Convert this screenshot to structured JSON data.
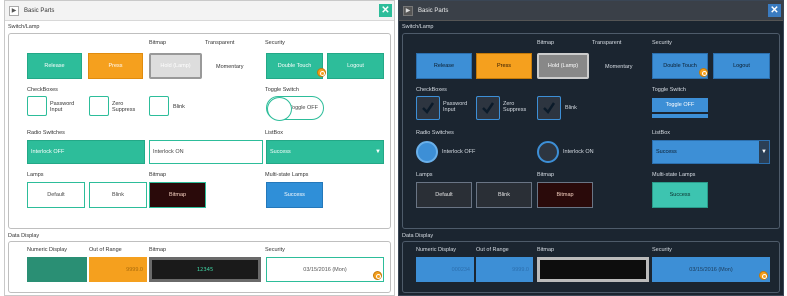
{
  "panels": [
    {
      "theme": "light",
      "title": "Basic Parts",
      "sections": {
        "switch_lamp": "Switch/Lamp",
        "data_display": "Data Display"
      },
      "switches": {
        "bitmap_label": "Bitmap",
        "transparent_label": "Transparent",
        "security_label": "Security",
        "release": "Release",
        "press": "Press",
        "bitmap_btn": "Hold (Lamp)",
        "momentary": "Momentary",
        "double_touch": "Double Touch",
        "logout": "Logout"
      },
      "checkboxes": {
        "label": "CheckBoxes",
        "items": [
          {
            "label": "Password Input",
            "checked": false
          },
          {
            "label": "Zero Suppress",
            "checked": false
          },
          {
            "label": "Blink",
            "checked": false
          }
        ]
      },
      "toggle": {
        "label": "Toggle Switch",
        "text": "Toggle OFF"
      },
      "radio": {
        "label": "Radio Switches",
        "interlock_off": "Interlock OFF",
        "interlock_on": "Interlock ON"
      },
      "listbox": {
        "label": "ListBox",
        "value": "Success",
        "arrow": "▼"
      },
      "lamps": {
        "label": "Lamps",
        "bitmap_label": "Bitmap",
        "multistate_label": "Multi-state Lamps",
        "default": "Default",
        "blink": "Blink",
        "bitmap": "Bitmap",
        "success": "Success"
      },
      "data_display": {
        "numeric_label": "Numeric Display",
        "out_of_range_label": "Out of Range",
        "bitmap_label": "Bitmap",
        "security_label": "Security",
        "numeric_value": "",
        "out_of_range_value": "9999.0",
        "lcd_text": "12345",
        "security_value": "03/15/2016 (Mon)"
      }
    },
    {
      "theme": "dark",
      "title": "Basic Parts",
      "sections": {
        "switch_lamp": "Switch/Lamp",
        "data_display": "Data Display"
      },
      "switches": {
        "bitmap_label": "Bitmap",
        "transparent_label": "Transparent",
        "security_label": "Security",
        "release": "Release",
        "press": "Press",
        "bitmap_btn": "Hold (Lamp)",
        "momentary": "Momentary",
        "double_touch": "Double Touch",
        "logout": "Logout"
      },
      "checkboxes": {
        "label": "CheckBoxes",
        "items": [
          {
            "label": "Password Input",
            "checked": true
          },
          {
            "label": "Zero Suppress",
            "checked": true
          },
          {
            "label": "Blink",
            "checked": true
          }
        ]
      },
      "toggle": {
        "label": "Toggle Switch",
        "text": "Toggle OFF"
      },
      "radio": {
        "label": "Radio Switches",
        "interlock_off": "Interlock OFF",
        "interlock_on": "Interlock ON"
      },
      "listbox": {
        "label": "ListBox",
        "value": "Success",
        "arrow": "▼"
      },
      "lamps": {
        "label": "Lamps",
        "bitmap_label": "Bitmap",
        "multistate_label": "Multi-state Lamps",
        "default": "Default",
        "blink": "Blink",
        "bitmap": "Bitmap",
        "success": "Success"
      },
      "data_display": {
        "numeric_label": "Numeric Display",
        "out_of_range_label": "Out of Range",
        "bitmap_label": "Bitmap",
        "security_label": "Security",
        "numeric_value": "000234",
        "out_of_range_value": "9999.0",
        "lcd_text": "",
        "security_value": "03/15/2016 (Mon)"
      }
    }
  ],
  "icons": {
    "play": "play-icon",
    "close": "close-icon",
    "lock": "lock-icon",
    "check": "checkmark-icon"
  }
}
